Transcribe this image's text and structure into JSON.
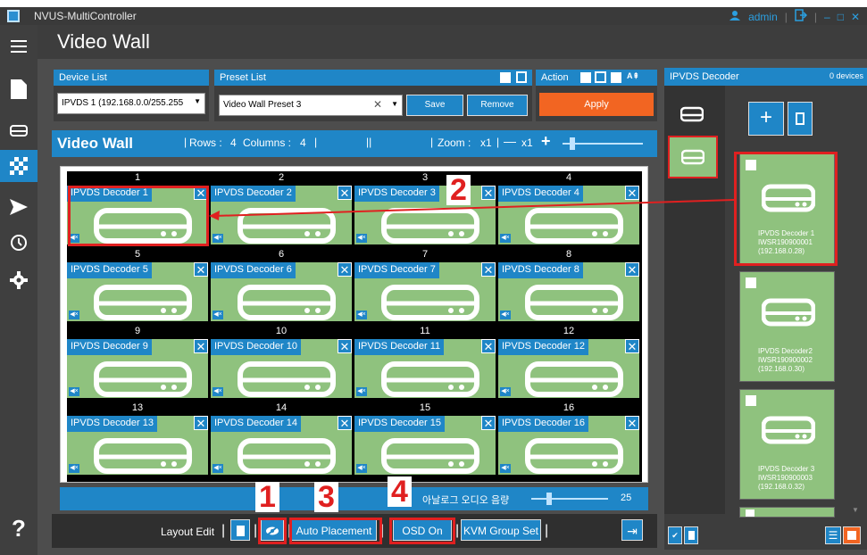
{
  "window": {
    "title": "NVUS-MultiController",
    "user": "admin",
    "minimize": "–",
    "maximize": "□",
    "close": "✕"
  },
  "page": {
    "title": "Video Wall"
  },
  "sidebar": {
    "items": [
      {
        "icon": "menu-icon"
      },
      {
        "icon": "file-icon"
      },
      {
        "icon": "device-icon"
      },
      {
        "icon": "videowall-icon",
        "active": true
      },
      {
        "icon": "send-icon"
      },
      {
        "icon": "clock-icon"
      },
      {
        "icon": "gear-icon"
      },
      {
        "icon": "help-icon",
        "label": "?"
      }
    ]
  },
  "device_list": {
    "heading": "Device List",
    "selected": "IPVDS 1 (192.168.0.0/255.255"
  },
  "preset_list": {
    "heading": "Preset List",
    "selected": "Video Wall Preset 3",
    "clear": "✕",
    "save_label": "Save",
    "remove_label": "Remove"
  },
  "action": {
    "heading": "Action",
    "apply_label": "Apply"
  },
  "video_wall": {
    "title": "Video Wall",
    "rows_label": "Rows :",
    "rows": "4",
    "columns_label": "Columns :",
    "columns": "4",
    "zoom_label": "Zoom :",
    "zoom_value": "x1",
    "zoom_value2": "x1",
    "minus": "—",
    "plus": "+",
    "column_numbers": [
      "1",
      "2",
      "3",
      "4"
    ],
    "cells": [
      [
        "IPVDS Decoder 1",
        "IPVDS Decoder 2",
        "IPVDS Decoder 3",
        "IPVDS Decoder 4"
      ],
      [
        "IPVDS Decoder 5",
        "IPVDS Decoder 6",
        "IPVDS Decoder 7",
        "IPVDS Decoder 8"
      ],
      [
        "IPVDS Decoder 9",
        "IPVDS Decoder 10",
        "IPVDS Decoder 11",
        "IPVDS Decoder 12"
      ],
      [
        "IPVDS Decoder 13",
        "IPVDS Decoder 14",
        "IPVDS Decoder 15",
        "IPVDS Decoder 16"
      ]
    ],
    "row_numbers": [
      [
        "1",
        "2",
        "3",
        "4"
      ],
      [
        "5",
        "6",
        "7",
        "8"
      ],
      [
        "9",
        "10",
        "11",
        "12"
      ],
      [
        "13",
        "14",
        "15",
        "16"
      ]
    ],
    "audio_label": "아날로그 오디오 음량",
    "audio_value": "25",
    "audio_level_fraction": 0.2
  },
  "toolbar": {
    "layout_edit_label": "Layout Edit",
    "auto_placement_label": "Auto Placement",
    "osd_label": "OSD On",
    "kvm_label": "KVM Group Set"
  },
  "callouts": [
    "1",
    "2",
    "3",
    "4"
  ],
  "right_panel": {
    "heading": "IPVDS Decoder",
    "count": "0 devices",
    "add": "+",
    "devices": [
      {
        "name": "IPVDS Decoder 1",
        "serial": "IWSR190900001",
        "ip": "(192.168.0.28)"
      },
      {
        "name": "IPVDS Decoder2",
        "serial": "IWSR190900002",
        "ip": "(192.168.0.30)"
      },
      {
        "name": "IPVDS Decoder 3",
        "serial": "IWSR190900003",
        "ip": "(192.168.0.32)"
      }
    ]
  },
  "colors": {
    "accent": "#1f86c7",
    "tile": "#8fc27e",
    "highlight": "#e02020",
    "apply": "#f26522"
  }
}
